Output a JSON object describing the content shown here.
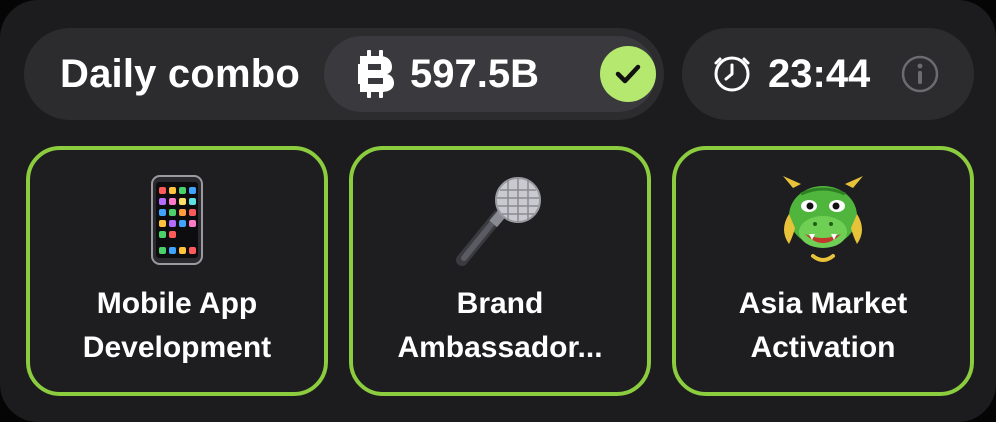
{
  "header": {
    "title": "Daily combo",
    "reward_amount": "597.5B",
    "reward_icon": "coin-icon",
    "claimed_icon": "check-icon",
    "timer": "23:44",
    "timer_icon": "clock-icon",
    "info_icon": "info-icon"
  },
  "cards": [
    {
      "icon": "mobile-phone-icon",
      "label_line1": "Mobile App",
      "label_line2": "Development"
    },
    {
      "icon": "microphone-icon",
      "label_line1": "Brand",
      "label_line2": "Ambassador..."
    },
    {
      "icon": "dragon-icon",
      "label_line1": "Asia Market",
      "label_line2": "Activation"
    }
  ],
  "colors": {
    "accent_green": "#8ccc3f",
    "check_green": "#b5e86e",
    "panel_bg": "#1c1c1e",
    "pill_bg": "#2c2c2f"
  }
}
